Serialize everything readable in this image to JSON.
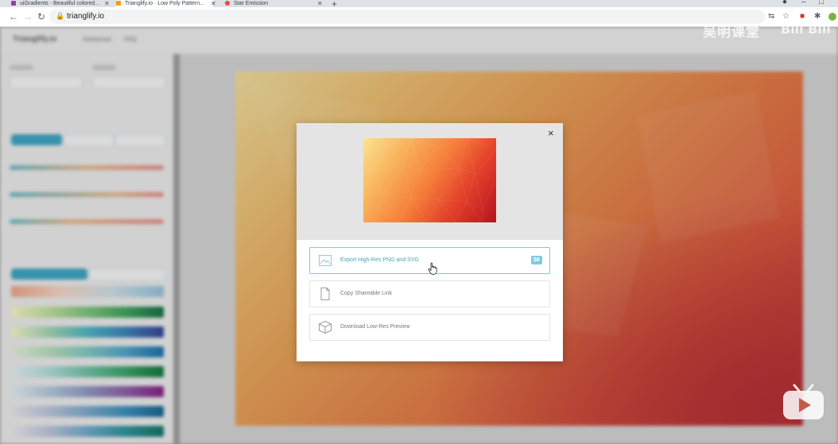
{
  "browser": {
    "tabs": [
      {
        "title": "uiGradients - Beautiful colored...",
        "favicon_color": "#8e44ad"
      },
      {
        "title": "Trianglify.io · Low Poly Pattern...",
        "favicon_color": "#f39c12"
      },
      {
        "title": "Star Emission",
        "favicon_color": "#e74c3c"
      }
    ],
    "new_tab": "+",
    "url": "trianglify.io",
    "window_controls": {
      "minimize": "–",
      "maximize": "□",
      "close": "✕"
    }
  },
  "app_background": {
    "logo": "Trianglify.io",
    "nav": [
      "Advanced",
      "FAQ"
    ]
  },
  "modal": {
    "close": "×",
    "options": [
      {
        "label": "Export High-Res PNG and SVG",
        "price": "$8",
        "icon": "image-icon"
      },
      {
        "label": "Copy Shareable Link",
        "icon": "document-icon"
      },
      {
        "label": "Download Low-Res Preview",
        "icon": "box-icon"
      }
    ]
  },
  "watermark": {
    "text": "吴明课堂",
    "logo": "Bili Bili"
  },
  "colors": {
    "accent": "#3aa6c2",
    "price_badge": "#7fcbe0"
  }
}
